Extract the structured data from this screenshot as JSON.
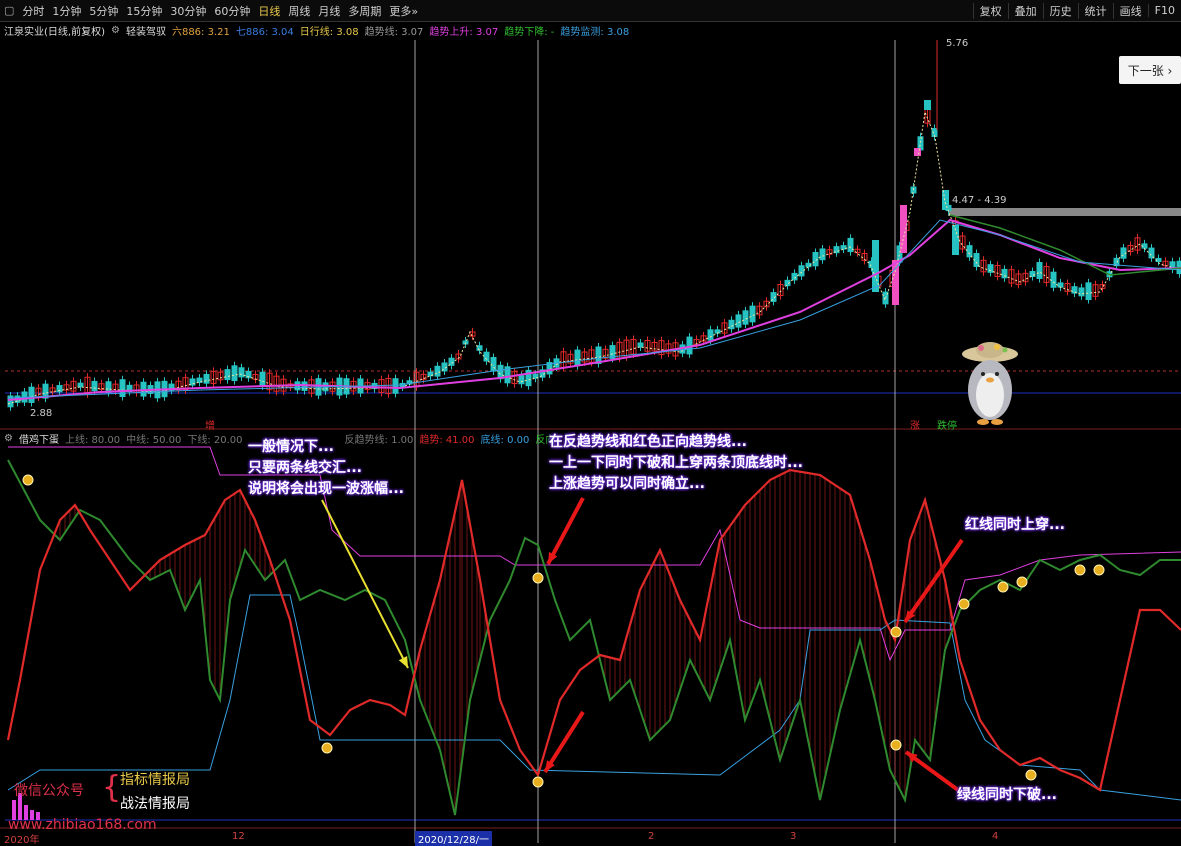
{
  "toolbar": {
    "items": [
      "分时",
      "1分钟",
      "5分钟",
      "15分钟",
      "30分钟",
      "60分钟",
      "日线",
      "周线",
      "月线",
      "多周期",
      "更多»"
    ],
    "active": "日线",
    "right_items": [
      "复权",
      "叠加",
      "历史",
      "统计",
      "画线",
      "F10"
    ]
  },
  "main_info": {
    "stock": "江泉实业(日线,前复权)",
    "indicator_name": "轻装驾驭",
    "ma6": "六886: 3.21",
    "ma7": "七886: 3.04",
    "day_line": "日行线: 3.08",
    "trend_line": "趋势线: 3.07",
    "trend_up": "趋势上升: 3.07",
    "trend_down": "趋势下降: -",
    "trend_monitor": "趋势监测: 3.08"
  },
  "sub_info": {
    "name": "借鸡下蛋",
    "upper": "上线: 80.00",
    "middle": "中线: 50.00",
    "lower": "下线: 20.00",
    "hidden": "反趋势线: 1.00",
    "trend": "趋势: 41.00",
    "blue": "底线: 0.00",
    "green": "反向"
  },
  "next_button": "下一张 ›",
  "price_labels": {
    "high": "5.76",
    "box": "4.47 - 4.39",
    "low": "2.88"
  },
  "markers": {
    "zeng": "增",
    "zhang": "涨",
    "dietong": "跌停"
  },
  "annotations": {
    "a1": [
      "一般情况下...",
      "只要两条线交汇...",
      "说明将会出现一波涨幅..."
    ],
    "a2": [
      "在反趋势线和红色正向趋势线...",
      "一上一下同时下破和上穿两条顶底线时...",
      "上涨趋势可以同时确立..."
    ],
    "a3": "红线同时上穿...",
    "a4": "绿线同时下破..."
  },
  "watermark": {
    "wechat": "微信公众号",
    "n1": "指标情报局",
    "n2": "战法情报局",
    "site": "www.zhibiao168.com"
  },
  "xaxis": {
    "year": "2020年",
    "m12": "12",
    "date": "2020/12/28/一",
    "m2": "2",
    "m3": "3",
    "m4": "4"
  },
  "colors": {
    "up": "#e02a2a",
    "down": "#27c2c2",
    "magenta": "#e040e0",
    "green": "#2f8a2f",
    "blue": "#39a0e0",
    "gold": "#e8c94a"
  }
}
